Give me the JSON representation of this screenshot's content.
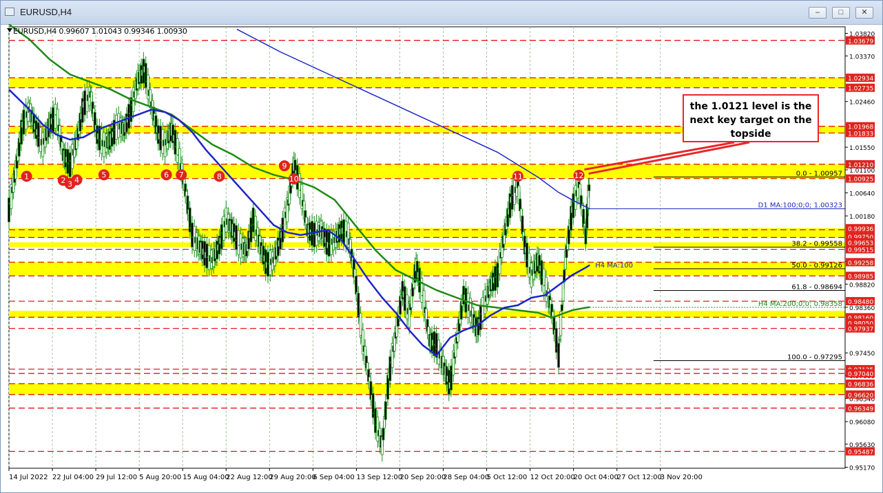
{
  "window": {
    "title": "EURUSD,H4"
  },
  "info": {
    "line": "EURUSD,H4  0.99607 1.01043 0.99346 1.00930"
  },
  "callout": {
    "lines": [
      "the 1.0121 level is the",
      "next key target on the",
      "topside"
    ]
  },
  "colors": {
    "yellow_zone": "#ffff00",
    "red_line": "#e00000",
    "price_box": "#e0231f",
    "blue_ma": "#1c24c8",
    "green_ma": "#1e8a14",
    "candles": "#1a8f1a",
    "grid": "#9ec29e"
  },
  "chart_data": {
    "type": "candlestick",
    "symbol": "EURUSD",
    "timeframe": "H4",
    "ylim": [
      0.9515,
      1.0395
    ],
    "y_ticks": [
      "1.03820",
      "1.03370",
      "1.02460",
      "1.01550",
      "1.01100",
      "1.00640",
      "1.00180",
      "0.99270",
      "0.98820",
      "0.98360",
      "0.97450",
      "0.97000",
      "0.96540",
      "0.96080",
      "0.95630",
      "0.95170"
    ],
    "x_labels": [
      "14 Jul 2022",
      "22 Jul 04:00",
      "29 Jul 12:00",
      "5 Aug 20:00",
      "15 Aug 04:00",
      "22 Aug 12:00",
      "29 Aug 20:00",
      "6 Sep 04:00",
      "13 Sep 12:00",
      "20 Sep 20:00",
      "28 Sep 04:00",
      "5 Oct 12:00",
      "12 Oct 20:00",
      "20 Oct 04:00",
      "27 Oct 12:00",
      "3 Nov 20:00"
    ],
    "x_positions": [
      0,
      32,
      64,
      96,
      128,
      160,
      192,
      224,
      256,
      288,
      320,
      352,
      384,
      416,
      448,
      480
    ],
    "x_range": [
      0,
      540
    ],
    "yellow_zones": [
      {
        "from": 1.02735,
        "to": 1.02934
      },
      {
        "from": 1.01833,
        "to": 1.01968
      },
      {
        "from": 1.00925,
        "to": 1.0121
      },
      {
        "from": 0.9975,
        "to": 0.99936
      },
      {
        "from": 0.9956,
        "to": 0.99653
      },
      {
        "from": 0.98985,
        "to": 0.99258
      },
      {
        "from": 0.9816,
        "to": 0.9829
      },
      {
        "from": 0.9662,
        "to": 0.96836
      }
    ],
    "red_levels": [
      1.03679,
      1.02934,
      1.02735,
      1.01968,
      1.01833,
      1.0121,
      1.00925,
      0.99905,
      0.9975,
      0.99515,
      0.99258,
      0.98985,
      0.9848,
      0.9816,
      0.97937,
      0.97125,
      0.9704,
      0.96836,
      0.9662,
      0.96349,
      0.95487
    ],
    "price_labels": [
      {
        "text": "1.03679",
        "y": 1.03679
      },
      {
        "text": "1.02934",
        "y": 1.02934
      },
      {
        "text": "1.02735",
        "y": 1.02735
      },
      {
        "text": "1.01968",
        "y": 1.01968
      },
      {
        "text": "1.01833",
        "y": 1.01833
      },
      {
        "text": "1.01210",
        "y": 1.0121
      },
      {
        "text": "1.00925",
        "y": 1.00925
      },
      {
        "text": "0.99905",
        "y": 0.99905
      },
      {
        "text": "0.99936",
        "y": 0.99936
      },
      {
        "text": "0.99750",
        "y": 0.9977
      },
      {
        "text": "0.99653",
        "y": 0.99653
      },
      {
        "text": "0.99515",
        "y": 0.99515
      },
      {
        "text": "0.99258",
        "y": 0.99258
      },
      {
        "text": "0.98985",
        "y": 0.98985
      },
      {
        "text": "0.98480",
        "y": 0.9848
      },
      {
        "text": "0.98160",
        "y": 0.9816
      },
      {
        "text": "0.98050",
        "y": 0.9805
      },
      {
        "text": "0.97937",
        "y": 0.97937
      },
      {
        "text": "0.97125",
        "y": 0.97125
      },
      {
        "text": "0.97040",
        "y": 0.9704
      },
      {
        "text": "0.96836",
        "y": 0.96836
      },
      {
        "text": "0.96620",
        "y": 0.9662
      },
      {
        "text": "0.96349",
        "y": 0.96349
      },
      {
        "text": "0.95487",
        "y": 0.95487
      }
    ],
    "fib_levels": [
      {
        "label": "0.0 - 1.00957",
        "y": 1.00957,
        "from": 475
      },
      {
        "label": "38.2 - 0.99558",
        "y": 0.99558,
        "from": 475
      },
      {
        "label": "50.0 - 0.99126",
        "y": 0.99126,
        "from": 475
      },
      {
        "label": "61.8 - 0.98694",
        "y": 0.98694,
        "from": 475
      },
      {
        "label": "100.0 - 0.97295",
        "y": 0.97295,
        "from": 475
      }
    ],
    "ma_labels": [
      {
        "text": "D1 MA:100;0;0; 1.00323",
        "y": 1.00323
      },
      {
        "text": "H4 MA:100",
        "y": 0.99126
      },
      {
        "text": "H4 MA:200;0;0; 0.98358",
        "y": 0.98358
      }
    ],
    "swing_markers": [
      {
        "n": "1",
        "x": 13,
        "y": 1.0097
      },
      {
        "n": "2",
        "x": 40,
        "y": 1.0089
      },
      {
        "n": "3",
        "x": 45,
        "y": 1.0082
      },
      {
        "n": "4",
        "x": 50,
        "y": 1.009
      },
      {
        "n": "5",
        "x": 70,
        "y": 1.01
      },
      {
        "n": "6",
        "x": 116,
        "y": 1.01
      },
      {
        "n": "7",
        "x": 127,
        "y": 1.01
      },
      {
        "n": "8",
        "x": 155,
        "y": 1.0097
      },
      {
        "n": "9",
        "x": 203,
        "y": 1.0118
      },
      {
        "n": "10",
        "x": 210,
        "y": 1.0092
      },
      {
        "n": "11",
        "x": 375,
        "y": 1.0097
      },
      {
        "n": "12",
        "x": 420,
        "y": 1.0099
      }
    ],
    "series": [
      {
        "name": "price",
        "x": [
          0,
          5,
          10,
          15,
          20,
          25,
          30,
          35,
          40,
          45,
          50,
          55,
          60,
          65,
          70,
          75,
          80,
          85,
          90,
          95,
          100,
          105,
          110,
          115,
          120,
          125,
          130,
          135,
          140,
          145,
          150,
          155,
          160,
          165,
          170,
          175,
          180,
          185,
          190,
          195,
          200,
          205,
          210,
          215,
          220,
          225,
          230,
          235,
          240,
          245,
          250,
          255,
          260,
          265,
          270,
          275,
          280,
          285,
          290,
          295,
          300,
          305,
          310,
          315,
          320,
          325,
          330,
          335,
          340,
          345,
          350,
          355,
          360,
          365,
          370,
          375,
          380,
          385,
          390,
          395,
          400,
          405,
          410,
          415,
          420,
          425,
          428
        ],
        "y": [
          1.003,
          1.011,
          1.02,
          1.023,
          1.019,
          1.016,
          1.02,
          1.022,
          1.014,
          1.012,
          1.017,
          1.024,
          1.026,
          1.018,
          1.016,
          1.017,
          1.02,
          1.019,
          1.023,
          1.029,
          1.031,
          1.024,
          1.018,
          1.016,
          1.019,
          1.014,
          1.007,
          0.998,
          0.996,
          0.994,
          0.993,
          0.996,
          1.001,
          0.999,
          0.996,
          0.995,
          1.001,
          0.996,
          0.992,
          0.993,
          0.997,
          1.003,
          1.012,
          1.007,
          0.999,
          0.998,
          0.999,
          0.996,
          0.997,
          0.999,
          0.998,
          0.99,
          0.978,
          0.97,
          0.961,
          0.956,
          0.97,
          0.978,
          0.987,
          0.982,
          0.992,
          0.986,
          0.977,
          0.976,
          0.972,
          0.968,
          0.977,
          0.986,
          0.983,
          0.979,
          0.984,
          0.988,
          0.99,
          0.998,
          1.005,
          1.008,
          0.996,
          0.99,
          0.993,
          0.988,
          0.983,
          0.974,
          0.993,
          1.003,
          1.008,
          0.998,
          1.0093
        ]
      },
      {
        "name": "H4 MA:100",
        "x": [
          0,
          15,
          25,
          35,
          45,
          55,
          65,
          75,
          85,
          95,
          105,
          115,
          125,
          135,
          145,
          155,
          165,
          175,
          185,
          195,
          205,
          215,
          225,
          235,
          245,
          255,
          265,
          275,
          285,
          295,
          305,
          315,
          325,
          335,
          345,
          355,
          365,
          375,
          385,
          395,
          405,
          415,
          425,
          428
        ],
        "y": [
          1.027,
          1.023,
          1.02,
          1.018,
          1.017,
          1.0175,
          1.019,
          1.02,
          1.021,
          1.022,
          1.023,
          1.0225,
          1.021,
          1.0185,
          1.015,
          1.012,
          1.009,
          1.006,
          1.003,
          1.0,
          0.9985,
          0.998,
          0.9985,
          0.999,
          0.997,
          0.993,
          0.989,
          0.9855,
          0.9825,
          0.979,
          0.976,
          0.974,
          0.9775,
          0.979,
          0.98,
          0.982,
          0.9835,
          0.984,
          0.9855,
          0.986,
          0.988,
          0.99,
          0.9915,
          0.992
        ]
      },
      {
        "name": "H4 MA:200",
        "x": [
          0,
          15,
          30,
          45,
          60,
          75,
          90,
          105,
          120,
          135,
          150,
          165,
          180,
          195,
          210,
          225,
          240,
          255,
          270,
          285,
          300,
          315,
          330,
          345,
          360,
          375,
          390,
          400,
          405,
          415,
          425,
          428
        ],
        "y": [
          1.04,
          1.037,
          1.033,
          1.03,
          1.0285,
          1.027,
          1.025,
          1.0235,
          1.022,
          1.019,
          1.016,
          1.014,
          1.0115,
          1.01,
          1.009,
          1.0075,
          1.005,
          1.0,
          0.995,
          0.991,
          0.989,
          0.987,
          0.9855,
          0.984,
          0.9835,
          0.983,
          0.9825,
          0.9815,
          0.982,
          0.983,
          0.9835,
          0.9836
        ]
      },
      {
        "name": "D1 MA:100",
        "x": [
          168,
          200,
          240,
          280,
          320,
          360,
          390,
          405,
          415,
          428
        ],
        "y": [
          1.039,
          1.0345,
          1.0295,
          1.0245,
          1.0195,
          1.0145,
          1.0095,
          1.0065,
          1.005,
          1.0032
        ]
      }
    ]
  }
}
